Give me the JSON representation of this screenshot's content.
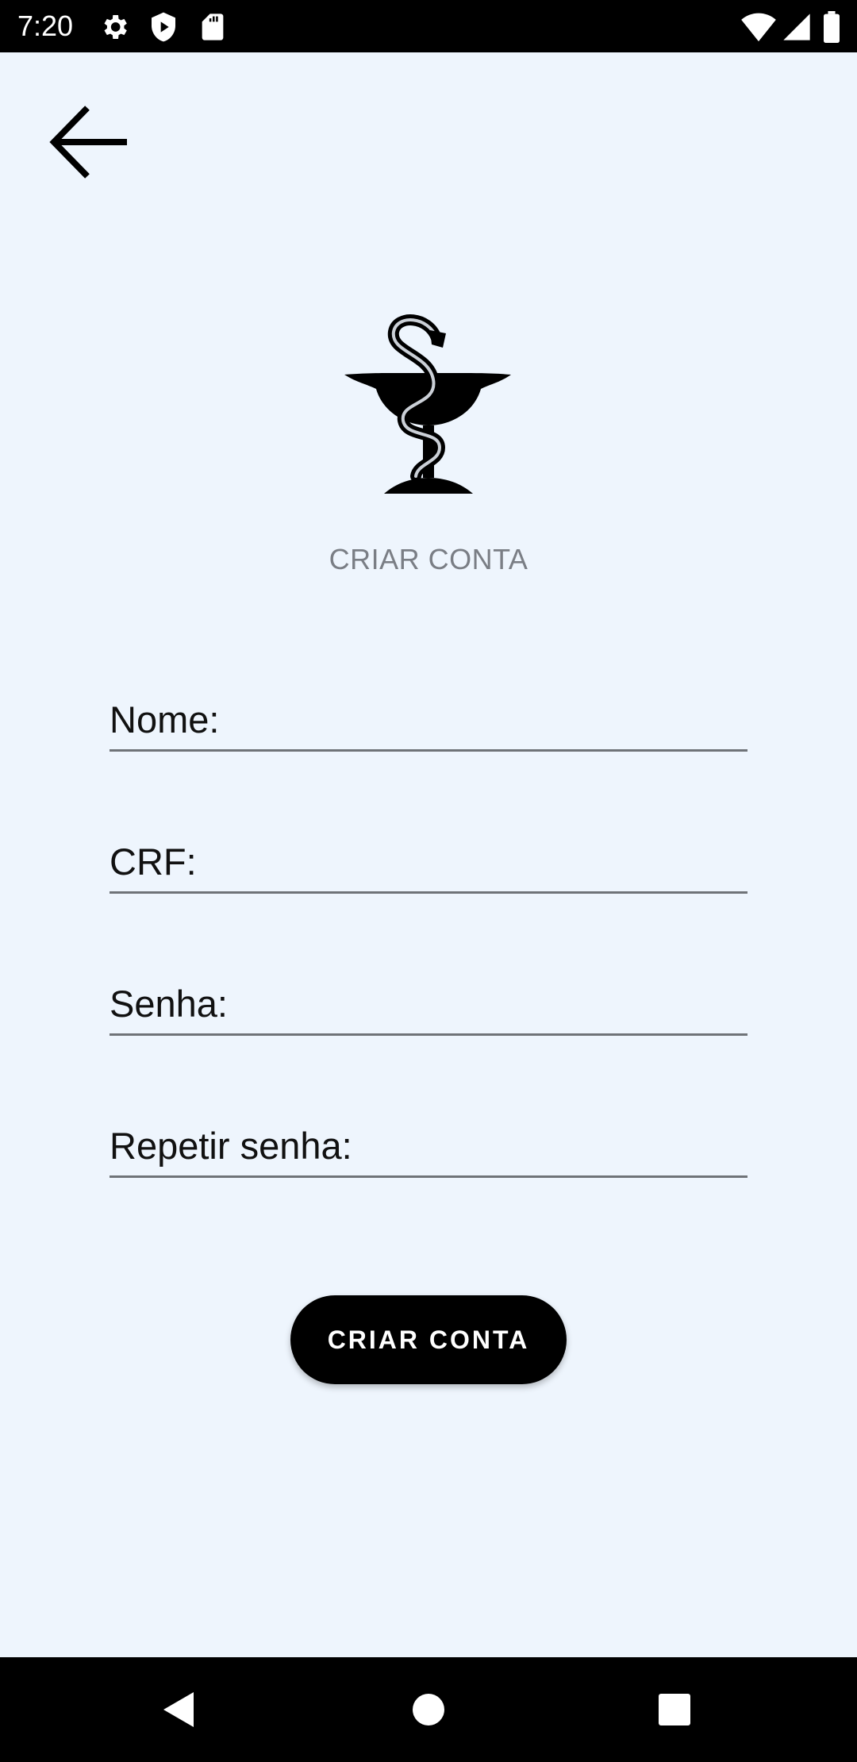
{
  "status_bar": {
    "time": "7:20",
    "icons_left": [
      "settings-icon",
      "shield-play-icon",
      "sd-card-icon"
    ],
    "icons_right": [
      "wifi-icon",
      "signal-icon",
      "battery-icon"
    ]
  },
  "header": {
    "back_icon": "arrow-back-icon"
  },
  "logo": {
    "icon": "pharmacy-bowl-of-hygieia-icon"
  },
  "page": {
    "subtitle": "CRIAR CONTA"
  },
  "form": {
    "fields": [
      {
        "label": "Nome:"
      },
      {
        "label": "CRF:"
      },
      {
        "label": "Senha:"
      },
      {
        "label": "Repetir senha:"
      }
    ],
    "submit_label": "CRIAR CONTA"
  },
  "navbar": {
    "back": "nav-back-icon",
    "home": "nav-home-icon",
    "recents": "nav-recents-icon"
  },
  "colors": {
    "background": "#eef5fd",
    "text": "#111111",
    "subtitle": "#7a7e85",
    "button": "#000000"
  }
}
